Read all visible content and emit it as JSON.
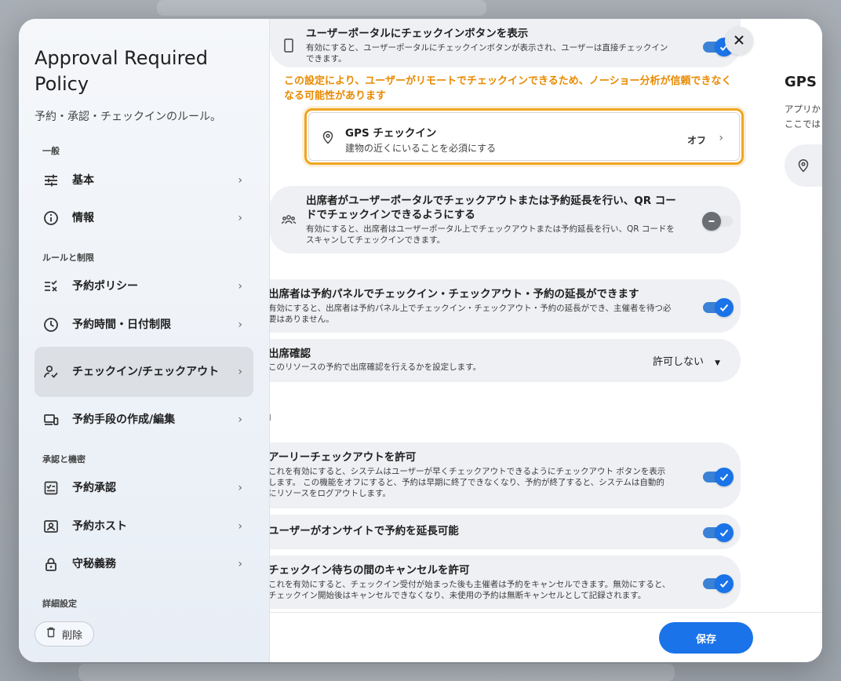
{
  "sidebar": {
    "title": "Approval Required Policy",
    "subtitle": "予約・承認・チェックインのルール。",
    "sections": {
      "general": "一般",
      "rules": "ルールと制限",
      "approval": "承認と機密",
      "advanced": "詳細設定"
    },
    "items": [
      {
        "label": "基本",
        "icon": "sliders-icon"
      },
      {
        "label": "情報",
        "icon": "info-icon"
      },
      {
        "label": "予約ポリシー",
        "icon": "checklist-icon"
      },
      {
        "label": "予約時間・日付制限",
        "icon": "clock-icon"
      },
      {
        "label": "チェックイン/チェックアウト",
        "icon": "person-check-icon"
      },
      {
        "label": "予約手段の作成/編集",
        "icon": "devices-icon"
      },
      {
        "label": "予約承認",
        "icon": "approval-icon"
      },
      {
        "label": "予約ホスト",
        "icon": "host-icon"
      },
      {
        "label": "守秘義務",
        "icon": "lock-icon"
      }
    ],
    "delete_label": "削除"
  },
  "main": {
    "portal_checkin": {
      "title": "ユーザーポータルにチェックインボタンを表示",
      "desc_1": "有効にすると、ユーザーポータルにチェックインボタンが表示され、ユーザーは直接チェックイン",
      "desc_2": "できます。",
      "enabled": true
    },
    "warning": "この設定により、ユーザーがリモートでチェックインできるため、ノーショー分析が信頼できなくなる可能性があります",
    "gps": {
      "title": "GPS チェックイン",
      "desc": "建物の近くにいることを必須にする",
      "value": "オフ"
    },
    "attendee_portal": {
      "title_1": "出席者がユーザーポータルでチェックアウトまたは予約延長を行い、QR コー",
      "title_2": "ドでチェックインできるようにする",
      "desc_1": "有効にすると、出席者はユーザーポータル上でチェックアウトまたは予約延長を行い、QR コードを",
      "desc_2": "スキャンしてチェックインできます。",
      "enabled": false
    },
    "attendee_panel": {
      "title": "出席者は予約パネルでチェックイン・チェックアウト・予約の延長ができます",
      "desc_1": "有効にすると、出席者は予約パネル上でチェックイン・チェックアウト・予約の延長ができ、主催者を待つ必",
      "desc_2": "要はありません。",
      "enabled": true
    },
    "attendance": {
      "title": "出席確認",
      "desc": "このリソースの予約で出席確認を行えるかを設定します。",
      "value": "許可しない"
    },
    "stray_char": "ı",
    "early_checkout": {
      "title": "アーリーチェックアウトを許可",
      "desc_1": "これを有効にすると、システムはユーザーが早くチェックアウトできるようにチェックアウト ボタンを表示",
      "desc_2": "します。 この機能をオフにすると、予約は早期に終了できなくなり、予約が終了すると、システムは自動的",
      "desc_3": "にリソースをログアウトします。",
      "enabled": true
    },
    "extend_onsite": {
      "title": "ユーザーがオンサイトで予約を延長可能",
      "enabled": true
    },
    "cancel_pending": {
      "title": "チェックイン待ちの間のキャンセルを許可",
      "desc_1": "これを有効にすると、チェックイン受付が始まった後も主催者は予約をキャンセルできます。無効にすると、",
      "desc_2": "チェックイン開始後はキャンセルできなくなり、未使用の予約は無断キャンセルとして記録されます。",
      "enabled": true
    },
    "save_label": "保存"
  },
  "peek": {
    "title": "GPS チ",
    "desc_1": "アプリか",
    "desc_2": "ここでは"
  },
  "colors": {
    "accent": "#1a73e8",
    "warning": "#e88a00",
    "highlight_border": "#f0a520"
  }
}
